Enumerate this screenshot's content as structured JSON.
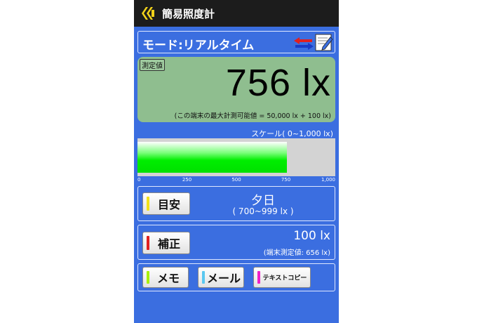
{
  "app": {
    "title": "簡易照度計"
  },
  "mode": {
    "label": "モード:リアルタイム"
  },
  "reading": {
    "tag": "測定値",
    "value": "756 lx",
    "note": "(この端末の最大計測可能値 = 50,000 lx + 100 lx)"
  },
  "scale": {
    "label": "スケール( 0~1,000 lx)",
    "min": 0,
    "max": 1000,
    "level": 756,
    "ticks": [
      "0",
      "250",
      "500",
      "750",
      "1,000"
    ]
  },
  "meyasu": {
    "button_label": "目安",
    "main": "夕日",
    "sub": "( 700~999 lx )"
  },
  "hosei": {
    "button_label": "補正",
    "main": "100 lx",
    "sub": "(端末測定値: 656 lx)"
  },
  "buttons": {
    "memo": "メモ",
    "mail": "メール",
    "copy": "テキストコピー"
  },
  "colors": {
    "background": "#3b6ee0",
    "titlebar": "#1c1c1c",
    "reading_panel": "#8fbe8f",
    "bar_fill": "#00e000",
    "stripe_meyasu": "#f2e21a",
    "stripe_hosei": "#e02020",
    "stripe_memo": "#a8f000",
    "stripe_mail": "#5ac8f0",
    "stripe_copy": "#f020c8"
  }
}
